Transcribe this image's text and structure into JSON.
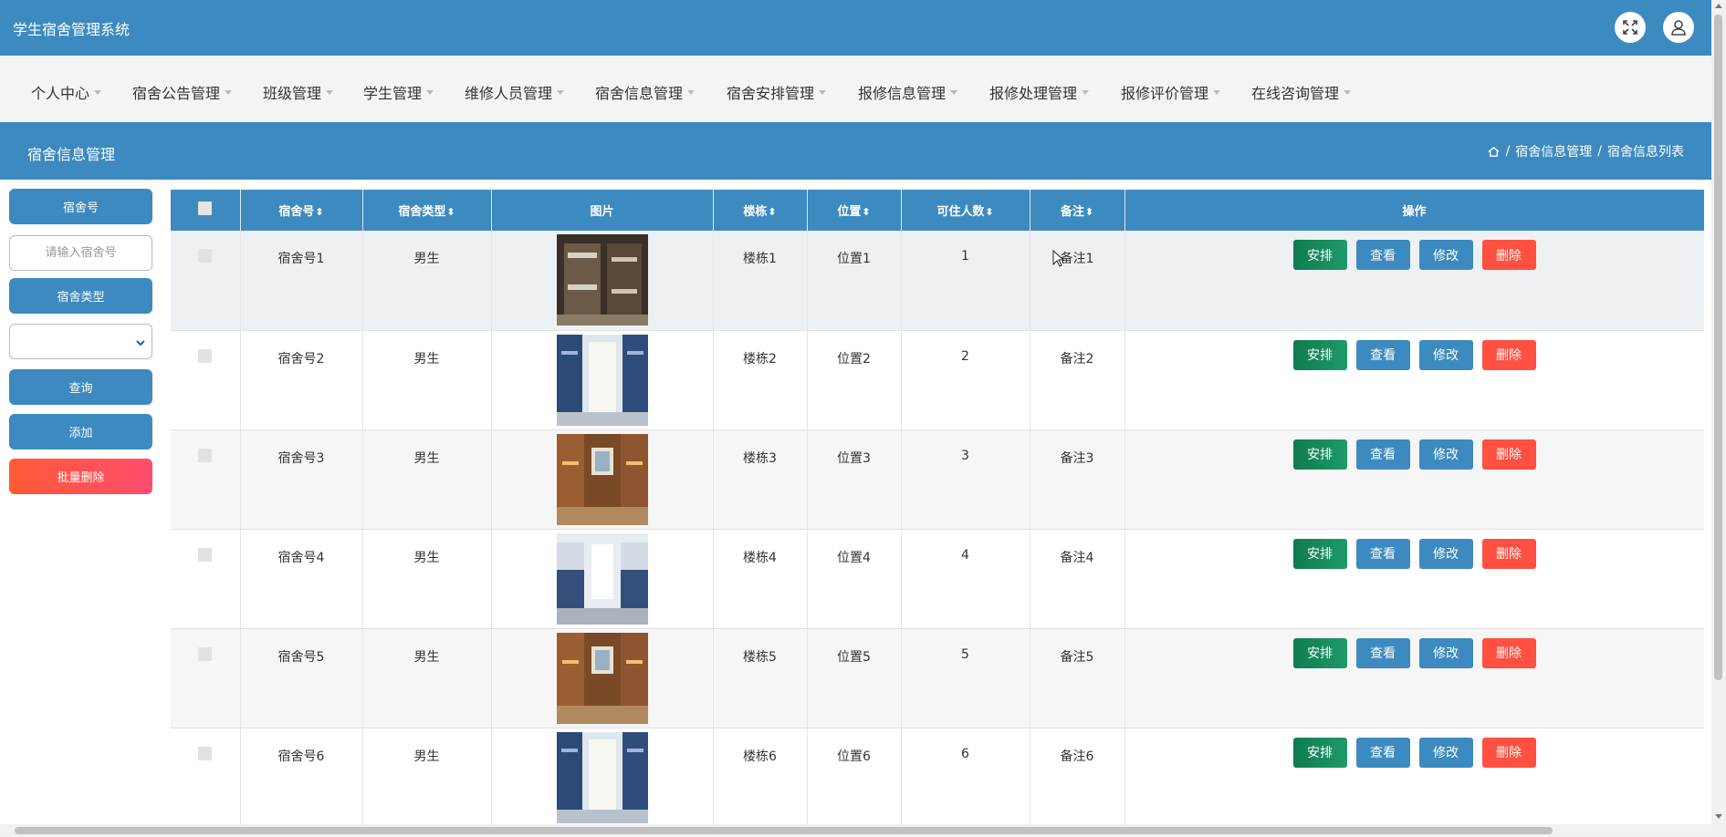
{
  "app": {
    "title": "学生宿舍管理系统"
  },
  "nav": [
    {
      "label": "个人中心"
    },
    {
      "label": "宿舍公告管理"
    },
    {
      "label": "班级管理"
    },
    {
      "label": "学生管理"
    },
    {
      "label": "维修人员管理"
    },
    {
      "label": "宿舍信息管理"
    },
    {
      "label": "宿舍安排管理"
    },
    {
      "label": "报修信息管理"
    },
    {
      "label": "报修处理管理"
    },
    {
      "label": "报修评价管理"
    },
    {
      "label": "在线咨询管理"
    }
  ],
  "page": {
    "title": "宿舍信息管理",
    "breadcrumb": [
      "宿舍信息管理",
      "宿舍信息列表"
    ]
  },
  "sidebar": {
    "room_label": "宿舍号",
    "room_placeholder": "请输入宿舍号",
    "type_label": "宿舍类型",
    "type_value": "",
    "search_label": "查询",
    "add_label": "添加",
    "batch_delete_label": "批量删除"
  },
  "table": {
    "headers": [
      "宿舍号",
      "宿舍类型",
      "图片",
      "楼栋",
      "位置",
      "可住人数",
      "备注",
      "操作"
    ],
    "rows": [
      {
        "room": "宿舍号1",
        "type": "男生",
        "image": "bunk-room-dark",
        "building": "楼栋1",
        "location": "位置1",
        "capacity": "1",
        "note": "备注1"
      },
      {
        "room": "宿舍号2",
        "type": "男生",
        "image": "bright-dorm-window",
        "building": "楼栋2",
        "location": "位置2",
        "capacity": "2",
        "note": "备注2"
      },
      {
        "room": "宿舍号3",
        "type": "男生",
        "image": "wooden-dorm",
        "building": "楼栋3",
        "location": "位置3",
        "capacity": "3",
        "note": "备注3"
      },
      {
        "room": "宿舍号4",
        "type": "男生",
        "image": "bright-dorm-hall",
        "building": "楼栋4",
        "location": "位置4",
        "capacity": "4",
        "note": "备注4"
      },
      {
        "room": "宿舍号5",
        "type": "男生",
        "image": "wooden-dorm",
        "building": "楼栋5",
        "location": "位置5",
        "capacity": "5",
        "note": "备注5"
      },
      {
        "room": "宿舍号6",
        "type": "男生",
        "image": "bright-dorm-window",
        "building": "楼栋6",
        "location": "位置6",
        "capacity": "6",
        "note": "备注6"
      }
    ],
    "actions": {
      "arrange": "安排",
      "view": "查看",
      "edit": "修改",
      "delete": "删除"
    }
  },
  "icons": [
    "fullscreen-icon",
    "user-icon",
    "home-icon",
    "sort-icon",
    "chevron-down-icon"
  ],
  "colors": {
    "primary": "#3d8ac0",
    "success": "#13845a",
    "danger": "#ff5041",
    "nav_bg": "#f4f4f4"
  }
}
